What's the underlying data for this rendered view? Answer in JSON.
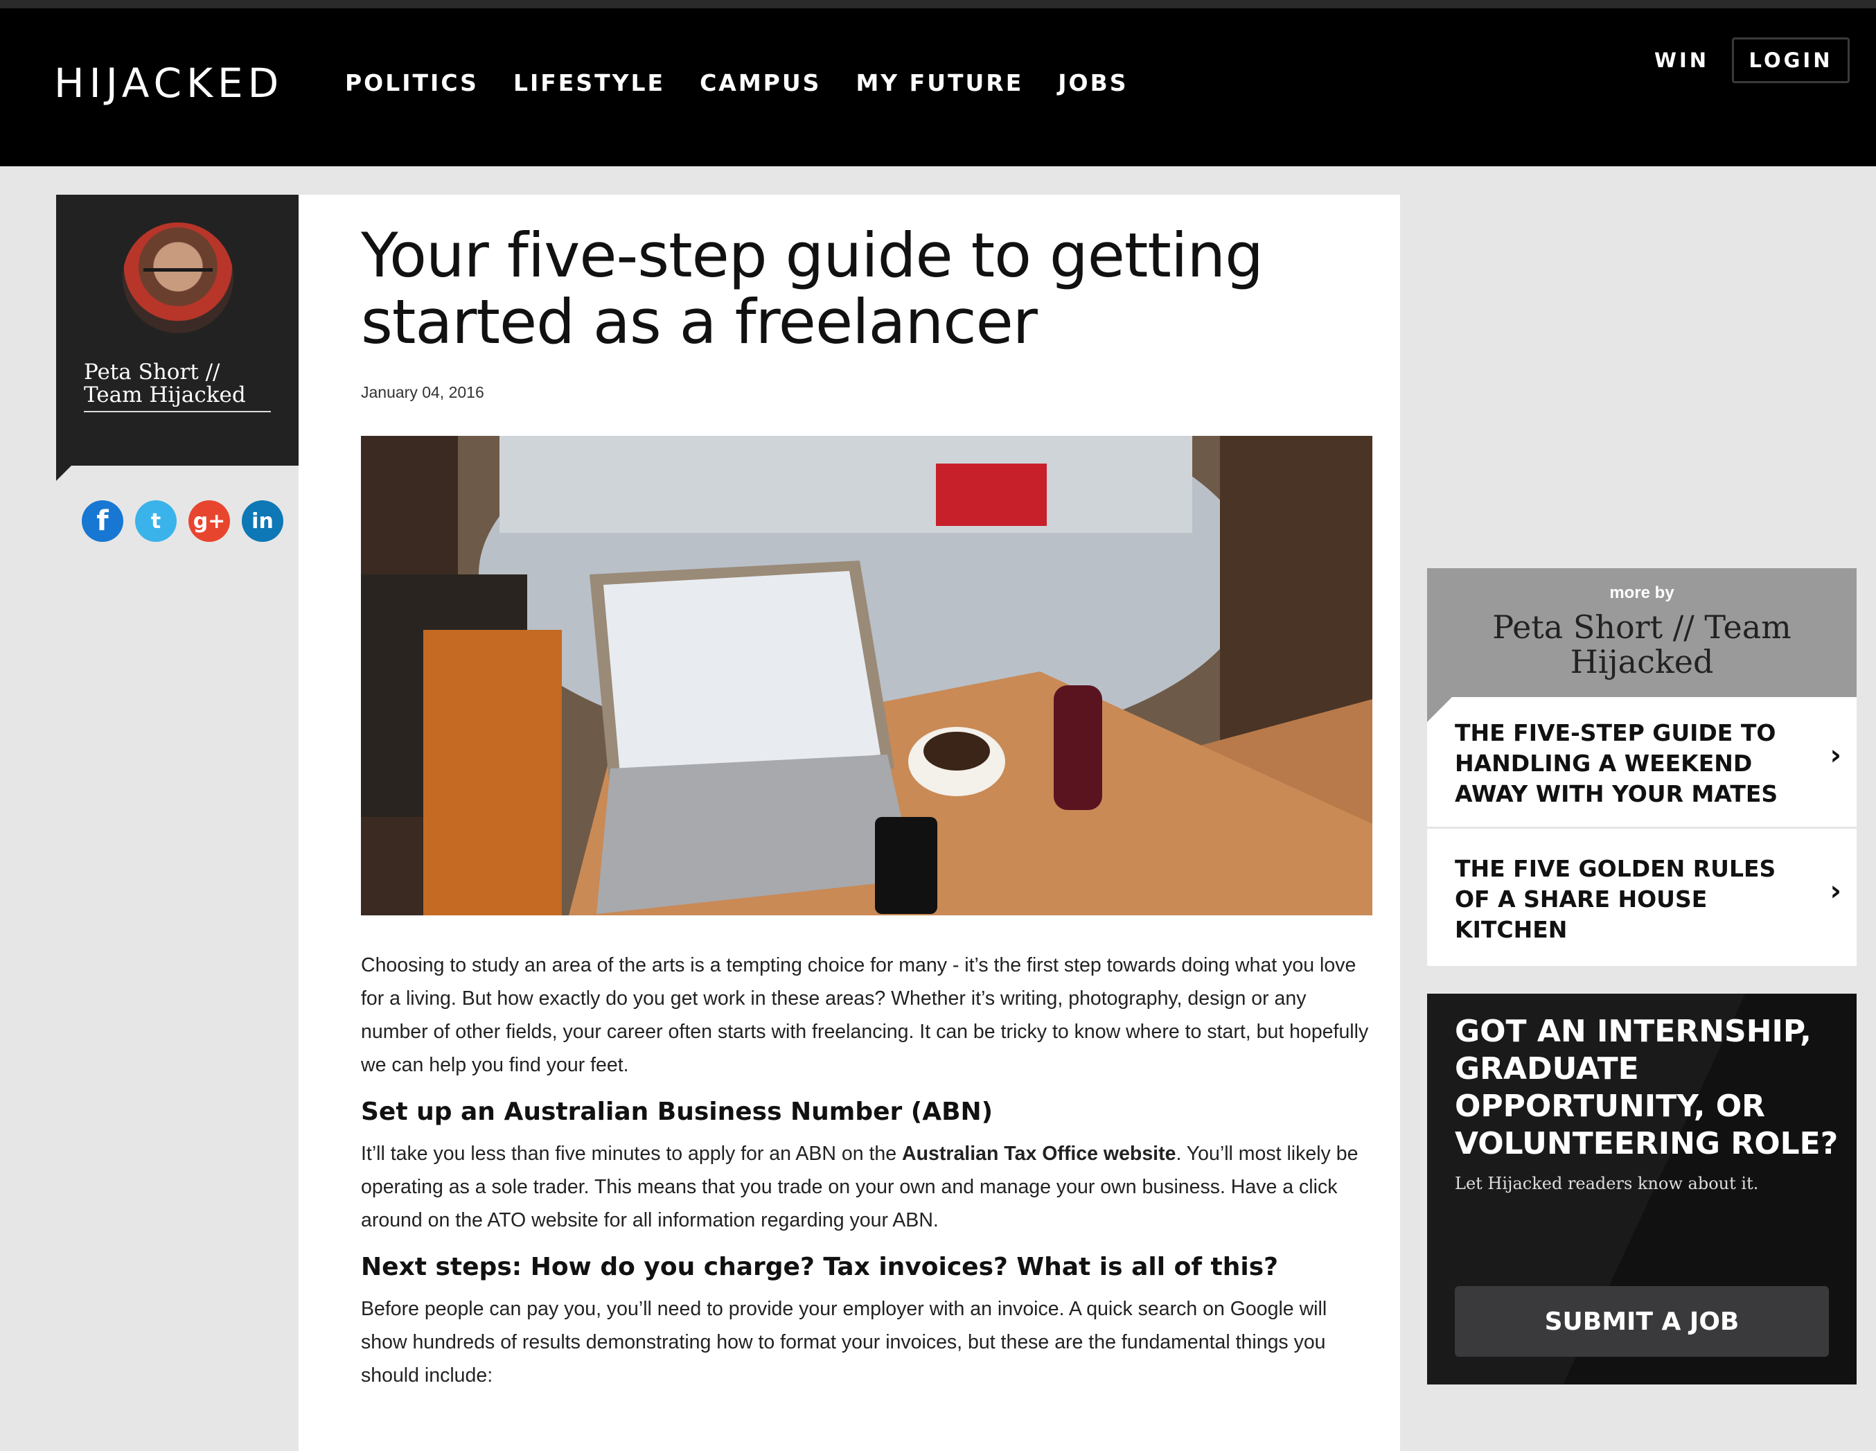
{
  "header": {
    "logo": "HIJACKED",
    "nav": [
      "POLITICS",
      "LIFESTYLE",
      "CAMPUS",
      "MY FUTURE",
      "JOBS"
    ],
    "win": "WIN",
    "login": "LOGIN"
  },
  "author": {
    "name": "Peta Short // Team Hijacked"
  },
  "social": {
    "facebook": "f",
    "twitter": "t",
    "googleplus": "g+",
    "linkedin": "in"
  },
  "article": {
    "title": "Your five-step guide to getting started as a freelancer",
    "date": "January 04, 2016",
    "intro": "Choosing to study an area of the arts is a tempting choice for many - it’s the first step towards doing what you love for a living. But how exactly do you get work in these areas? Whether it’s writing, photography, design or any number of other fields, your career often starts with freelancing. It can be tricky to know where to start, but hopefully we can help you find your feet.",
    "h1": "Set up an Australian Business Number (ABN)",
    "p2_before": "It’ll take you less than five minutes to apply for an ABN on the ",
    "p2_link": "Australian Tax Office website",
    "p2_after": ". You’ll most likely be operating as a sole trader. This means that you trade on your own and manage your own business. Have a click around on the ATO website for all information regarding your ABN.",
    "h2": "Next steps: How do you charge? Tax invoices? What is all of this?",
    "p3": "Before people can pay you, you’ll need to provide your employer with an invoice. A quick search on Google will show hundreds of results demonstrating how to format your invoices, but these are the fundamental things you should include:"
  },
  "more_by": {
    "label": "more by",
    "author": "Peta Short // Team Hijacked",
    "items": [
      "THE FIVE-STEP GUIDE TO HANDLING A WEEKEND AWAY WITH YOUR MATES",
      "THE FIVE GOLDEN RULES OF A SHARE HOUSE KITCHEN"
    ]
  },
  "job_ad": {
    "title": "GOT AN INTERNSHIP, GRADUATE OPPORTUNITY, OR VOLUNTEERING ROLE?",
    "subtitle": "Let Hijacked readers know about it.",
    "button": "SUBMIT A JOB"
  }
}
